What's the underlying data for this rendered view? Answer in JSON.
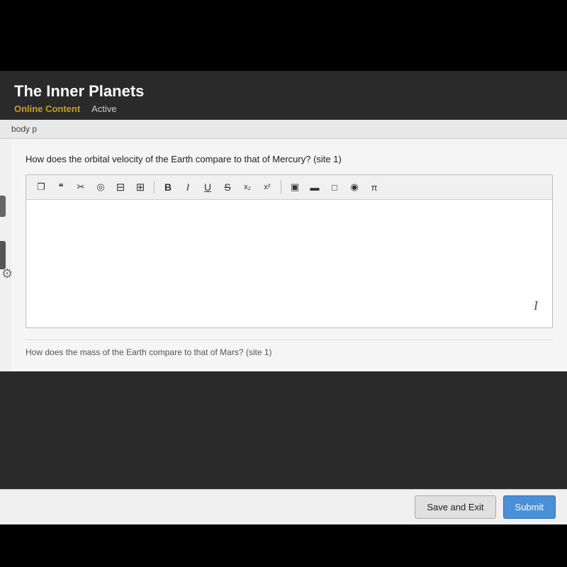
{
  "header": {
    "title": "The Inner Planets",
    "nav_online_content": "Online Content",
    "nav_active": "Active"
  },
  "breadcrumb": {
    "text": "body  p"
  },
  "question": {
    "label": "How does the orbital velocity of the Earth compare to that of Mercury? (site 1)"
  },
  "toolbar": {
    "copy_icon": "❐",
    "quote_icon": "❝",
    "cut_icon": "✂",
    "target_icon": "◎",
    "indent_decrease": "≡",
    "indent_increase": "≡",
    "bold": "B",
    "italic": "I",
    "underline": "U",
    "strikethrough": "S",
    "subscript": "x₂",
    "superscript": "x²",
    "media_icon": "▣",
    "media2_icon": "▬",
    "box_icon": "□",
    "globe_icon": "◉",
    "pi_icon": "π"
  },
  "editor": {
    "placeholder": ""
  },
  "next_question_preview": "How does the mass of the Earth compare to that of Mars? (site 1)",
  "footer": {
    "save_exit_label": "Save and Exit",
    "submit_label": "Submit"
  }
}
